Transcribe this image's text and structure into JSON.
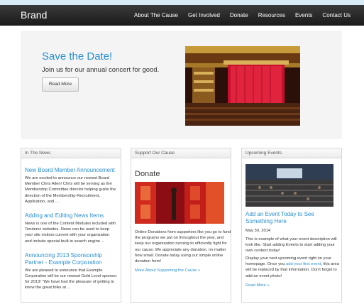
{
  "brand": "Brand",
  "nav": [
    "About The Cause",
    "Get Involved",
    "Donate",
    "Resources",
    "Events",
    "Contact Us"
  ],
  "hero": {
    "title": "Save the Date!",
    "subtitle": "Join us for our annual concert for good.",
    "button": "Read More"
  },
  "news": {
    "heading": "In The News",
    "items": [
      {
        "title": "New Board Member Announcement",
        "body": "We are excited to announce our newest Board Member Chris Allen! Chris will be serving as the Membership Committee director helping guide the direction of the Membership Recruitment, Application, and ..."
      },
      {
        "title": "Adding and Editing News Items",
        "body": "News is one of the Content Modules included with Tendenci websites. News can be used to keep your site visitors current with your organization and include special built-in search engine ..."
      },
      {
        "title": "Announcing 2013 Sponsorship Partner - Example Corporation",
        "body": "We are pleased to announce that Example Corporation will be our newest Gold Level sponsor for 2013! \"We have had the pleasure of getting to know the great folks at ..."
      }
    ]
  },
  "support": {
    "heading": "Support Our Cause",
    "title": "Donate",
    "body": "Online Donations from supporters like you go to fund the programs we put on throughout the year, and keep our organization running to efficiently fight for our cause. We appreciate any donation, no matter how small. Donate today using our simple online donation form!",
    "link": "More About Supporting the Cause »"
  },
  "events": {
    "heading": "Upcoming Events",
    "title": "Add an Event Today to See Something Here",
    "date": "May 30, 2014",
    "body1": "This is example of what your event description will look like. Start adding Events to start adding your own content today!",
    "body2_pre": "Display your next upcoming event right on your homepage. Once you ",
    "body2_link": "add your first event",
    "body2_post": ", this area will be replaced by that information. Don't forget to add an event photo!",
    "link": "Read More »"
  }
}
